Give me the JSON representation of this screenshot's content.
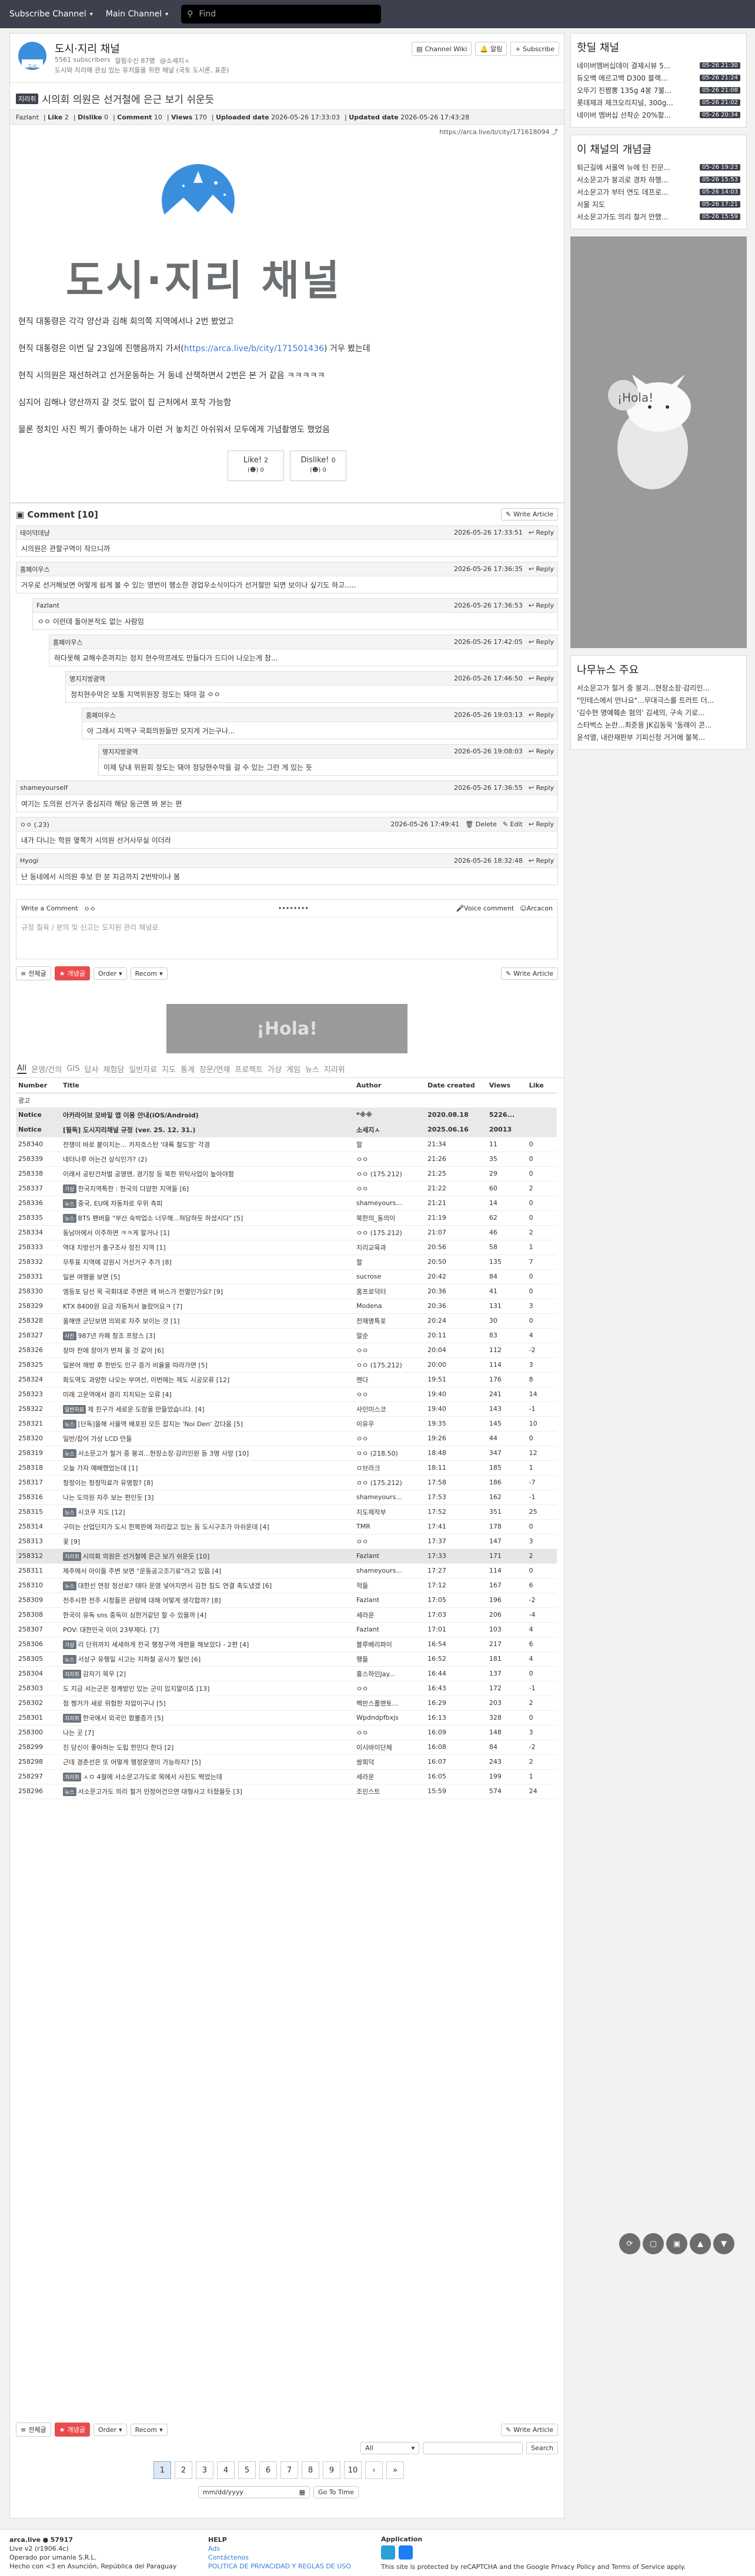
{
  "nav": {
    "subscribe_channel": "Subscribe Channel",
    "main_channel": "Main Channel",
    "find": "Find"
  },
  "channel": {
    "name": "도시·지리 채널",
    "subscribers": "5561 subscribers",
    "desc_pre": "알림수신 87명",
    "desc_mgr": "@소세지ㅅ",
    "desc": "도시와 지리에 관심 있는 유저들을 위한 채널 (국토 도시론, 표준)",
    "wiki": "Channel Wiki",
    "alert": "알림",
    "subscribe": "+ Subscribe"
  },
  "article": {
    "category": "지리취",
    "title": "시의회 의원은 선거철에 은근 보기 쉬운듯",
    "author": "Fazlant",
    "like_label": "Like",
    "like": "2",
    "dislike_label": "Dislike",
    "dislike": "0",
    "comment_label": "Comment",
    "comment": "10",
    "views_label": "Views",
    "views": "170",
    "uploaded_label": "Uploaded date",
    "uploaded": "2026-05-26 17:33:03",
    "updated_label": "Updated date",
    "updated": "2026-05-26 17:43:28",
    "url": "https://arca.live/b/city/171618094",
    "logo_text": "도시·지리 채널",
    "p1": "현직 대통령은 각각 양산과 김해 회의쪽 지역에서나 2번 봤었고",
    "p2a": "현직 대통령은 이번 달 23일에 진행음까지 가서(",
    "p2link": "https://arca.live/b/city/171501436",
    "p2b": ") 거우 봤는데",
    "p3": "현직 시의원은 재선하려고 선거운동하는 거 동네 산책하면서 2번은 본 거 같음 ㅋㅋㅋㅋㅋ",
    "p4": "심지어 김해나 양산까지 갈 것도 없이 집 근처에서 포착 가능함",
    "p5": "물론 정치인 사진 찍기 좋아하는 내가 이런 거 놓치긴 아쉬워서 모두에게 기념촬영도 했었음",
    "like_btn": "Like!",
    "like_btn_val": "2",
    "dislike_btn": "Dislike!",
    "dislike_btn_val": "0",
    "like_sub": "0",
    "dislike_sub": "0"
  },
  "comments": {
    "header": "Comment [10]",
    "write": "Write Article",
    "reply": "Reply",
    "delete": "Delete",
    "edit": "Edit",
    "items": [
      {
        "user": "테이덕데냥",
        "date": "2026-05-26 17:33:51",
        "text": "시의원은 관할구역이 작으니까",
        "indent": 0
      },
      {
        "user": "홈페이우스",
        "date": "2026-05-26 17:36:35",
        "text": "거우로 선거해보면 어떻게 쉽게 볼 수 있는 영번이 행소한 경업우소식이다가 선거철만 되면 보이나 싶기도 하고.....",
        "indent": 0
      },
      {
        "user": "Fazlant",
        "date": "2026-05-26 17:36:53",
        "text": "ㅇㅇ 이런데 돌아본적도 없는 사람임",
        "indent": 1
      },
      {
        "user": "홈페이우스",
        "date": "2026-05-26 17:42:05",
        "text": "하다못해 교해수준까지는 정치 현수막프레도 만들다가 드디어 나오는게 참...",
        "indent": 2
      },
      {
        "user": "명지지방광역",
        "date": "2026-05-26 17:46:50",
        "text": "정치현수막은 보통 지역위원장 정도는 돼야 걸 ㅇㅇ",
        "indent": 3
      },
      {
        "user": "홈페이우스",
        "date": "2026-05-26 19:03:13",
        "text": "아 그래서 지역구 국회의원들만 모지게 거는구나...",
        "indent": 4
      },
      {
        "user": "명지지방광역",
        "date": "2026-05-26 19:08:03",
        "text": "이제 당내 위원회 정도는 돼야 정당현수막을 걸 수 있는 그런 게 있는 듯",
        "indent": 5
      },
      {
        "user": "shameyourself",
        "date": "2026-05-26 17:36:55",
        "text": "여기는 도의원 선거구 중심지라 해당 동근엔 봐 본는 편",
        "indent": 0
      },
      {
        "user": "ㅇㅇ (.23)",
        "date": "2026-05-26 17:49:41",
        "text": "내가 다니는 학원 옆쪽가 시의원 선거사무실 이더라",
        "indent": 0,
        "own": true
      },
      {
        "user": "Hyogi",
        "date": "2026-05-26 18:32:48",
        "text": "난 동네에서 시의원 후보 한 분 지금까지 2번박이나 봄",
        "indent": 0
      }
    ],
    "write_label": "Write a Comment",
    "anon": "ㅇㅇ",
    "password": "••••••••",
    "voice": "Voice comment",
    "arcacon": "Arcacon",
    "placeholder": "규정 칠육 / 분의 및 신고는 도지원 관리 채널로"
  },
  "board": {
    "all": "전체글",
    "best": "개념글",
    "order": "Order",
    "recom": "Recom",
    "write": "Write Article",
    "tabs": [
      "All",
      "운영/건의",
      "GIS",
      "답사",
      "체험담",
      "일반자료",
      "지도",
      "통계",
      "장문/연재",
      "프로젝트",
      "가상",
      "게임",
      "뉴스",
      "지리위"
    ],
    "cols": {
      "number": "Number",
      "title": "Title",
      "author": "Author",
      "date": "Date created",
      "views": "Views",
      "like": "Like"
    },
    "ad": "광고",
    "notices": [
      {
        "label": "Notice",
        "title": "아카라이브 모바일 앱 이용 안내(iOS/Android)",
        "author": "*※※",
        "date": "2020.08.18",
        "views": "5226...",
        "like": ""
      },
      {
        "label": "Notice",
        "title": "[필독] 도시지리채널 규정 (ver. 25. 12. 31.)",
        "author": "소세지ㅅ",
        "date": "2025.06.16",
        "views": "20013",
        "like": ""
      }
    ],
    "rows": [
      [
        "258340",
        "",
        "전쟁이 바로 붙이지는... 카자흐스탄 '대륙 철도망' 각경",
        "할",
        "21:34",
        "11",
        "0"
      ],
      [
        "258339",
        "",
        "네터나루 어는건 상식인가? (2)",
        "ㅇㅇ",
        "21:26",
        "35",
        "0"
      ],
      [
        "258338",
        "",
        "이래서 공탄건처벌 공영엔, 경기장 등 북한 위탁사업이 높아야함",
        "ㅇㅇ (175.212)",
        "21:25",
        "29",
        "0"
      ],
      [
        "258337",
        "가상",
        "한국지역특한 : 한국의 다양한 지역들 [6]",
        "ㅇㅇ",
        "21:22",
        "60",
        "2"
      ],
      [
        "258336",
        "뉴스",
        "중국, EU에 자동차로 우위 측피",
        "shameyours...",
        "21:21",
        "14",
        "0"
      ],
      [
        "258335",
        "뉴스",
        "BTS 팬버들 \"부산 숙박업소 너무해...혀당하듯 하셨시다\" [5]",
        "북한의_동의이",
        "21:19",
        "62",
        "0"
      ],
      [
        "258334",
        "",
        "동남아에서 이주하면 ㅋㅋ게 할거나 [1]",
        "ㅇㅇ (175.212)",
        "21:07",
        "46",
        "2"
      ],
      [
        "258333",
        "",
        "역대 지방선거 출구조사 정진 지역 [1]",
        "지리교육과",
        "20:56",
        "58",
        "1"
      ],
      [
        "258332",
        "",
        "무투표 지역에 강원시 거선거구 추가 [8]",
        "할",
        "20:50",
        "135",
        "7"
      ],
      [
        "258331",
        "",
        "일본 여행을 보면 [5]",
        "sucrose",
        "20:42",
        "84",
        "0"
      ],
      [
        "258330",
        "",
        "엠등포 당선 목 국회대로 주변은 왜 버스가 전멸인가요? [9]",
        "홈프로덕터",
        "20:36",
        "41",
        "0"
      ],
      [
        "258329",
        "",
        "KTX 8400원 요금 자동처서 놀랐어요ㅋ [7]",
        "Modena",
        "20:36",
        "131",
        "3"
      ],
      [
        "258328",
        "",
        "올해엔 군단보면 의외로 자주 보이는 것 [1]",
        "전재명특포",
        "20:24",
        "30",
        "0"
      ],
      [
        "258327",
        "사진",
        "987년 카페 창조 프랑스 [3]",
        "말순",
        "20:11",
        "83",
        "4"
      ],
      [
        "258326",
        "",
        "장마 전에 장아가 번져 올 것 같아 [6]",
        "ㅇㅇ",
        "20:04",
        "112",
        "-2"
      ],
      [
        "258325",
        "",
        "일본어 해방 후 한반도 인구 증가 비율을 따라가면 [5]",
        "ㅇㅇ (175.212)",
        "20:00",
        "114",
        "3"
      ],
      [
        "258324",
        "",
        "화도역도 과양한 나오는 부여선, 이번에는 제도 시공모류 [12]",
        "멘다",
        "19:51",
        "176",
        "8"
      ],
      [
        "258323",
        "",
        "미래 고운역에서 경리 지치되는 오류 [4]",
        "ㅇㅇ",
        "19:40",
        "241",
        "14"
      ],
      [
        "258322",
        "일반자료",
        "제 친구가 세로운 도랑을 만들었습니다. [4]",
        "사인미스코",
        "19:40",
        "143",
        "-1"
      ],
      [
        "258321",
        "뉴스",
        "[단독]올해 서울역 배포된 모든 잡지는 'Noi Den' 갔다옴 [5]",
        "이유우",
        "19:35",
        "145",
        "10"
      ],
      [
        "258320",
        "",
        "일반/잡어 가상 LCD 만들",
        "ㅇㅇ",
        "19:26",
        "44",
        "0"
      ],
      [
        "258319",
        "뉴스",
        "서소문고가 철거 중 붕괴...현장소장·감리인원 등 3명 사망 [10]",
        "ㅇㅇ (218.50)",
        "18:48",
        "347",
        "12"
      ],
      [
        "258318",
        "",
        "오늘 가자 예배했었는데 [1]",
        "ㅁ브라크",
        "18:11",
        "185",
        "1"
      ],
      [
        "258317",
        "",
        "청정이는 청정믹료가 유명함? [8]",
        "ㅇㅇ (175.212)",
        "17:58",
        "186",
        "-7"
      ],
      [
        "258316",
        "",
        "나는 도의원 자주 보는 편인듯 [3]",
        "shameyours...",
        "17:53",
        "162",
        "-1"
      ],
      [
        "258315",
        "뉴스",
        "시코쿠 지도 [12]",
        "지도제작부",
        "17:52",
        "351",
        "25"
      ],
      [
        "258314",
        "",
        "구미는 산업단지가 도시 한복판에 자리잡고 있는 등 도시구조가 아쉬운데 [4]",
        "TMR",
        "17:41",
        "178",
        "0"
      ],
      [
        "258313",
        "",
        "꽃 [9]",
        "ㅇㅇ",
        "17:37",
        "147",
        "3"
      ],
      [
        "258312",
        "지리취",
        "시의회 의원은 선거철에 은근 보기 쉬운듯 [10]",
        "Fazlant",
        "17:33",
        "171",
        "2"
      ],
      [
        "258311",
        "",
        "제주에서 아이들 주변 보면 \"운동공고조기료\"라고 있음 [4]",
        "shameyours...",
        "17:27",
        "114",
        "0"
      ],
      [
        "258310",
        "뉴스",
        "대한선 연장 정선로? 태타 운영 넣어지면서 김천 침도 연결 축도냈겠 [6]",
        "적들",
        "17:12",
        "167",
        "6"
      ],
      [
        "258309",
        "",
        "전주시한 전주 시청들은 관람에 대해 어떻게 생각합까? [8]",
        "Fazlant",
        "17:05",
        "196",
        "-2"
      ],
      [
        "258308",
        "",
        "한국이 유독 sns 중독이 심한거같던 할 수 있을까 [4]",
        "세라운",
        "17:03",
        "206",
        "-4"
      ],
      [
        "258307",
        "",
        "POV: 대한민국 이이 23부제다. [7]",
        "Fazlant",
        "17:01",
        "103",
        "4"
      ],
      [
        "258306",
        "가상",
        "리 단위까지 세세하게 전국 행정구역 개편을 해보았다 - 2편 [4]",
        "블루베리파이",
        "16:54",
        "217",
        "6"
      ],
      [
        "258305",
        "뉴스",
        "서상구 유행일 시고는 지하철 공사가 될언 [6]",
        "행들",
        "16:52",
        "181",
        "4"
      ],
      [
        "258304",
        "지리취",
        "감자기 목우 [2]",
        "홍스하인Jay...",
        "16:44",
        "137",
        "0"
      ],
      [
        "258303",
        "",
        "도 지금 서는군은 정계방인 있는 군이 있지말이죠 [13]",
        "ㅇㅇ",
        "16:43",
        "172",
        "-1"
      ],
      [
        "258302",
        "",
        "점 쩡거가 새로 위험한 자압이구나 [5]",
        "벡반스폴맨토...",
        "16:29",
        "203",
        "2"
      ],
      [
        "258301",
        "지리취",
        "한국에서 외국인 함불증가 [5]",
        "Wpdndpfbxjs",
        "16:13",
        "328",
        "0"
      ],
      [
        "258300",
        "",
        "나는 곳 [7]",
        "ㅇㅇ",
        "16:09",
        "148",
        "3"
      ],
      [
        "258299",
        "",
        "진 당신이 좋아하는 도립 한민다 한다 [2]",
        "이시바이단체",
        "16:08",
        "84",
        "-2"
      ],
      [
        "258298",
        "",
        "근데 경춘선은 또 어떻게 행정운영이 가능하지? [5]",
        "쌍회덕",
        "16:07",
        "243",
        "2"
      ],
      [
        "258297",
        "지리취",
        "ㅅㅁ 4월에 서소문고가도로 목에서 사진도 찍었는데",
        "세라운",
        "16:05",
        "199",
        "1"
      ],
      [
        "258296",
        "뉴스",
        "서소문고가도 의리 철거 인정어건으면 대형사고 터졌을듯 [3]",
        "조인스트",
        "15:59",
        "574",
        "24"
      ]
    ],
    "pages": [
      "1",
      "2",
      "3",
      "4",
      "5",
      "6",
      "7",
      "8",
      "9",
      "10"
    ],
    "search_scope": "All",
    "search": "Search",
    "date_placeholder": "mm/dd/yyyy",
    "goto": "Go To Time"
  },
  "side": {
    "hot_title": "핫딜 채널",
    "hot": [
      {
        "t": "네이버멤버십데이 결제시뷰 5...",
        "d": "05-26 21:30"
      },
      {
        "t": "듀오백 에르고백 D300 블랙...",
        "d": "05-26 21:24"
      },
      {
        "t": "오뚜기 진짬뽕 135g 4봉 7불...",
        "d": "05-26 21:08"
      },
      {
        "t": "롯데제과 제크오리지널, 300g...",
        "d": "05-26 21:02"
      },
      {
        "t": "네이버 멤버십 선착순 20%할...",
        "d": "05-26 20:34"
      }
    ],
    "best_title": "이 채널의 개념글",
    "best": [
      {
        "t": "퇴근길에 서울역 뉴에 틴 진문...",
        "d": "05-26 19:23"
      },
      {
        "t": "서소문고가 붕괴로 경차 하행...",
        "d": "05-26 15:53"
      },
      {
        "t": "서소문고가 부터 연도 데프로...",
        "d": "05-26 14:03"
      },
      {
        "t": "서울 지도",
        "d": "05-26 17:21"
      },
      {
        "t": "서소문고가도 의리 철거 안했...",
        "d": "05-26 15:59"
      }
    ],
    "ad_text": "¡Hola!",
    "news_title": "나무뉴스 주요",
    "news": [
      "서소문고가 철거 중 붕괴...현장소장·감리인...",
      "\"인테스에서 만나요\"...무대극스를 트러트 더...",
      "'김수현 명예훼손 혐의' 김세의, 구속 기로...",
      "스타벅스 논란...최준용 JK김동욱 '동래이 콘...",
      "윤석열, 내란재판부 기피신청 거거에 불복..."
    ]
  },
  "footer": {
    "brand": "arca.live",
    "users": "57917",
    "version": "Live v2 (r1906.4c)",
    "op": "Operado por umanle S.R.L.",
    "made": "Hecho con <3 en Asunción, República del Paraguay",
    "help_title": "HELP",
    "help": [
      "Ads",
      "Contáctenos",
      "POLITICA DE PRIVACIDAD Y REGLAS DE USO"
    ],
    "app_title": "Application",
    "recaptcha": "This site is protected by reCAPTCHA and the Google Privacy Policy and Terms of Service apply."
  }
}
